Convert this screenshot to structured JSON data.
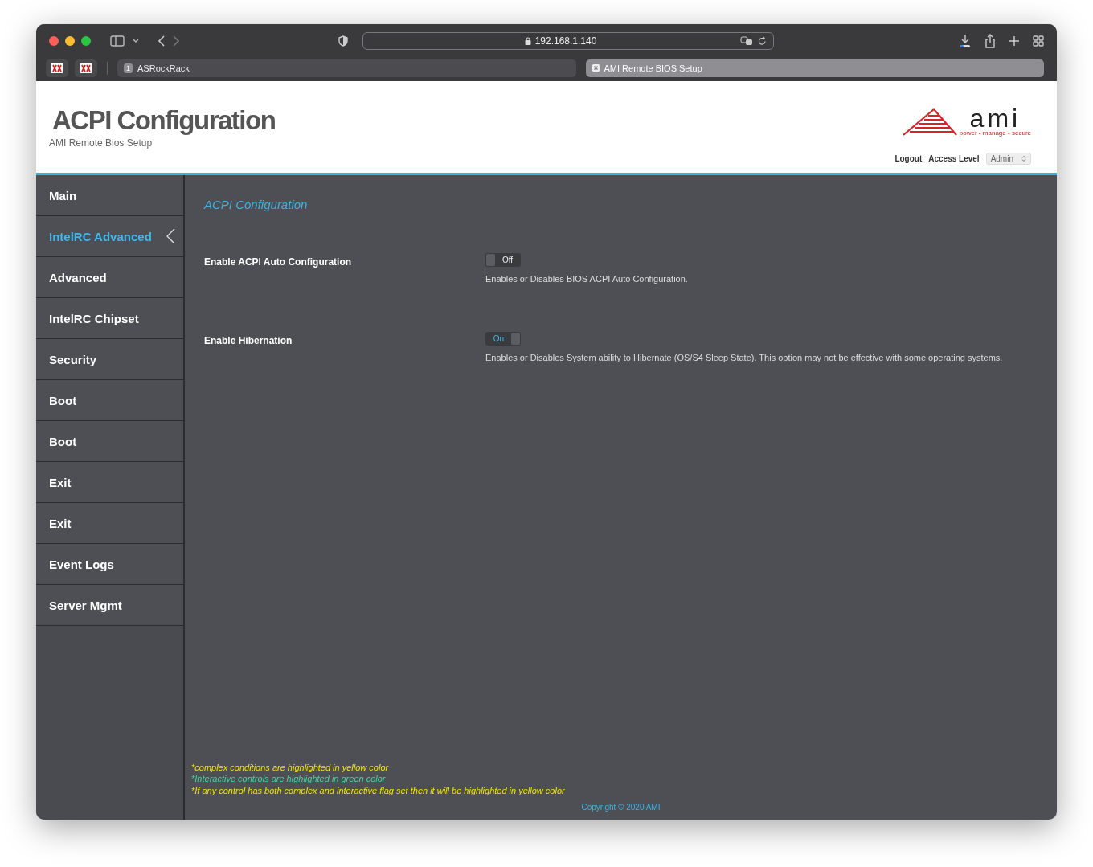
{
  "browser": {
    "url": "192.168.1.140",
    "tabs": [
      {
        "label": "ASRockRack",
        "badge": "1",
        "selected": false
      },
      {
        "label": "AMI Remote BIOS Setup",
        "selected": true
      }
    ]
  },
  "header": {
    "title": "ACPI Configuration",
    "subtitle": "AMI Remote Bios Setup",
    "logo_text": "ami",
    "logo_tagline": "power • manage • secure",
    "logout": "Logout",
    "access_label": "Access Level",
    "access_value": "Admin"
  },
  "sidebar": {
    "items": [
      {
        "label": "Main",
        "selected": false
      },
      {
        "label": "IntelRC Advanced",
        "selected": true
      },
      {
        "label": "Advanced",
        "selected": false
      },
      {
        "label": "IntelRC Chipset",
        "selected": false
      },
      {
        "label": "Security",
        "selected": false
      },
      {
        "label": "Boot",
        "selected": false
      },
      {
        "label": "Boot",
        "selected": false
      },
      {
        "label": "Exit",
        "selected": false
      },
      {
        "label": "Exit",
        "selected": false
      },
      {
        "label": "Event Logs",
        "selected": false
      },
      {
        "label": "Server Mgmt",
        "selected": false
      }
    ]
  },
  "page": {
    "heading": "ACPI Configuration",
    "settings": [
      {
        "label": "Enable ACPI Auto Configuration",
        "on": false,
        "state_text": "Off",
        "description": "Enables or Disables BIOS ACPI Auto Configuration."
      },
      {
        "label": "Enable Hibernation",
        "on": true,
        "state_text": "On",
        "description": "Enables or Disables System ability to Hibernate (OS/S4 Sleep State). This option may not be effective with some operating systems."
      }
    ]
  },
  "notes": [
    {
      "text": "*complex conditions are highlighted in yellow color",
      "color": "#f2e600"
    },
    {
      "text": "*Interactive controls are highlighted in green color",
      "color": "#3ed6a0"
    },
    {
      "text": "*If any control has both complex and interactive flag set then it will be highlighted in yellow color",
      "color": "#f2e600"
    }
  ],
  "copyright": "Copyright © 2020 AMI"
}
